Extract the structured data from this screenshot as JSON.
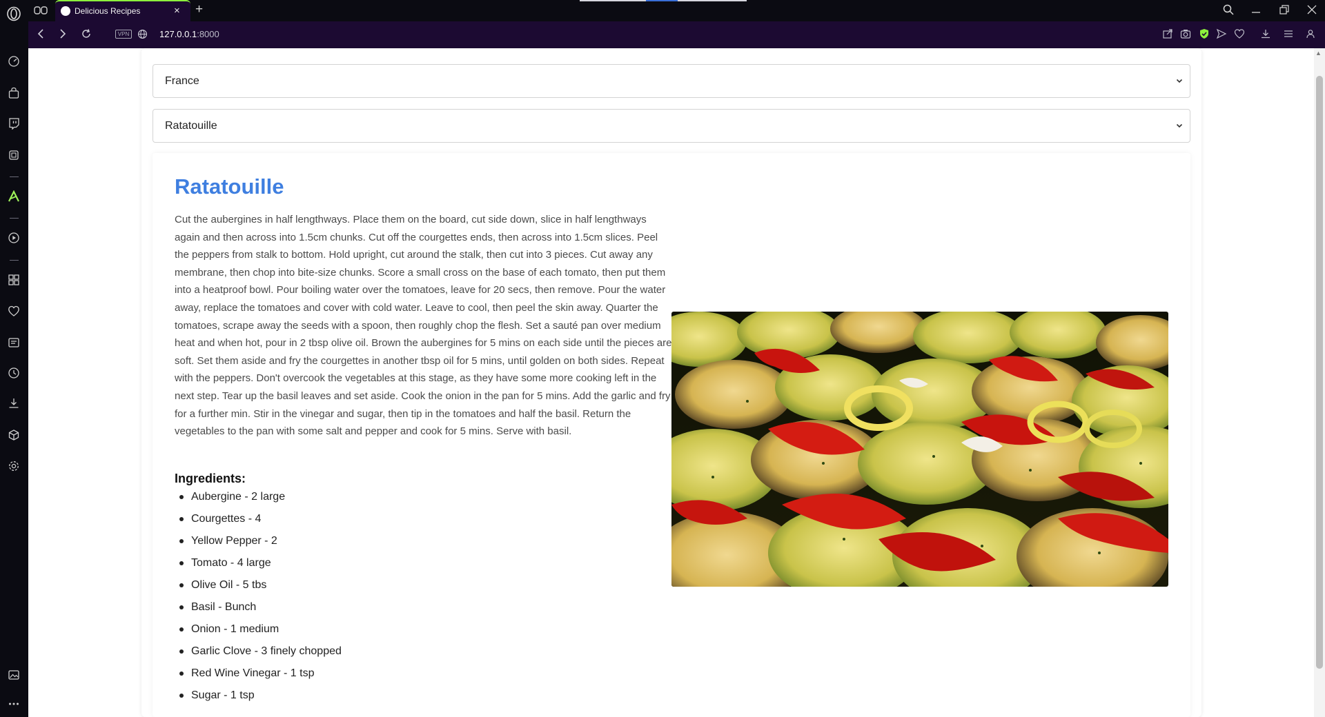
{
  "browser": {
    "tab_title": "Delicious Recipes",
    "tab_close": "×",
    "new_tab": "+",
    "vpn_badge": "VPN",
    "url_host": "127.0.0.1",
    "url_port": ":8000"
  },
  "page": {
    "country_select": {
      "value": "France"
    },
    "recipe_select": {
      "value": "Ratatouille"
    },
    "recipe": {
      "title": "Ratatouille",
      "instructions": "Cut the aubergines in half lengthways. Place them on the board, cut side down, slice in half lengthways again and then across into 1.5cm chunks. Cut off the courgettes ends, then across into 1.5cm slices. Peel the peppers from stalk to bottom. Hold upright, cut around the stalk, then cut into 3 pieces. Cut away any membrane, then chop into bite-size chunks. Score a small cross on the base of each tomato, then put them into a heatproof bowl. Pour boiling water over the tomatoes, leave for 20 secs, then remove. Pour the water away, replace the tomatoes and cover with cold water. Leave to cool, then peel the skin away. Quarter the tomatoes, scrape away the seeds with a spoon, then roughly chop the flesh. Set a sauté pan over medium heat and when hot, pour in 2 tbsp olive oil. Brown the aubergines for 5 mins on each side until the pieces are soft. Set them aside and fry the courgettes in another tbsp oil for 5 mins, until golden on both sides. Repeat with the peppers. Don't overcook the vegetables at this stage, as they have some more cooking left in the next step. Tear up the basil leaves and set aside. Cook the onion in the pan for 5 mins. Add the garlic and fry for a further min. Stir in the vinegar and sugar, then tip in the tomatoes and half the basil. Return the vegetables to the pan with some salt and pepper and cook for 5 mins. Serve with basil.",
      "ingredients_title": "Ingredients:",
      "ingredients": [
        "Aubergine - 2 large",
        "Courgettes - 4",
        "Yellow Pepper - 2",
        "Tomato - 4 large",
        "Olive Oil - 5 tbs",
        "Basil - Bunch",
        "Onion - 1 medium",
        "Garlic Clove - 3 finely chopped",
        "Red Wine Vinegar - 1 tsp",
        "Sugar - 1 tsp"
      ]
    }
  },
  "colors": {
    "title_bar": "#0b0b12",
    "toolbar": "#1c0a32",
    "tab_accent": "#8cf03c",
    "recipe_title": "#3f7fe0"
  },
  "icons": {
    "browser": [
      "opera-logo",
      "back-icon",
      "forward-icon",
      "reload-icon",
      "globe-icon",
      "search-icon",
      "minimize-icon",
      "restore-icon",
      "close-window-icon"
    ],
    "toolbar_right": [
      "share-icon",
      "camera-icon",
      "shield-icon",
      "send-icon",
      "heart-icon",
      "download-icon",
      "menu-icon",
      "account-icon"
    ],
    "sidebar": [
      "speed-dial-icon",
      "shopping-icon",
      "twitch-icon",
      "ai-chip-icon",
      "aria-icon",
      "player-icon",
      "workspaces-icon",
      "bookmarks-icon",
      "notes-icon",
      "history-icon",
      "downloads-icon",
      "extensions-icon",
      "settings-icon",
      "gallery-icon",
      "more-icon"
    ]
  }
}
